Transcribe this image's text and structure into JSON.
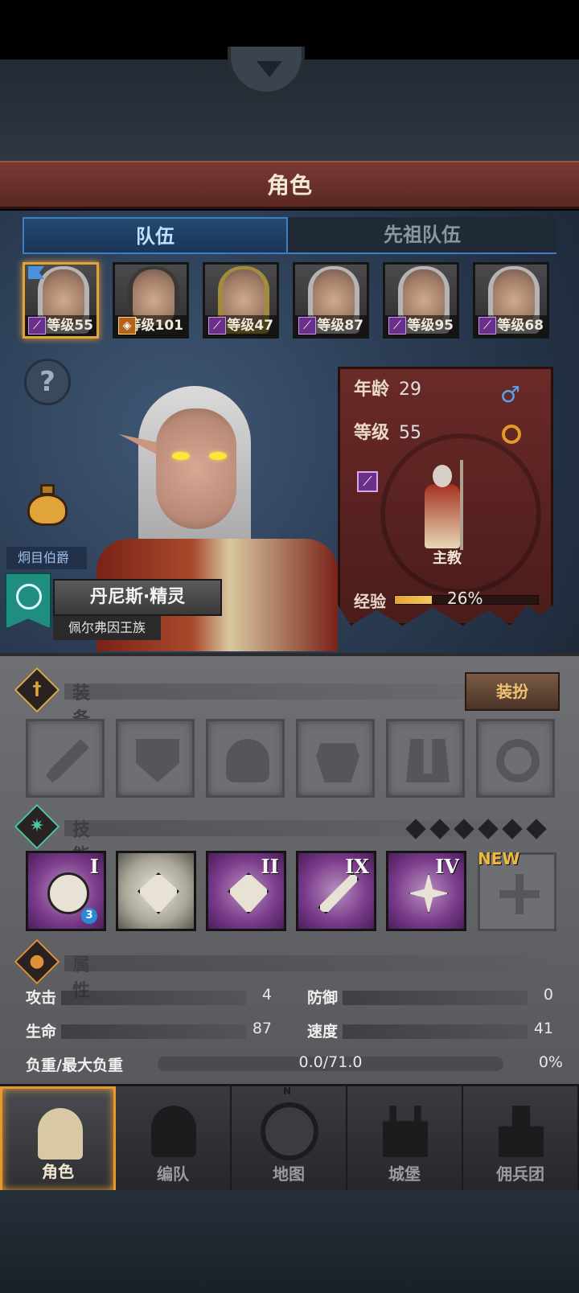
{
  "header": {
    "title": "角色"
  },
  "tabs": [
    {
      "label": "队伍",
      "active": true
    },
    {
      "label": "先祖队伍",
      "active": false
    }
  ],
  "roster": [
    {
      "level": "等级55",
      "class_icon": "staff-icon",
      "hair": "silver",
      "selected": true
    },
    {
      "level": "等级101",
      "class_icon": "shield-icon",
      "hair": "dark",
      "selected": false
    },
    {
      "level": "等级47",
      "class_icon": "staff-icon",
      "hair": "gold",
      "selected": false
    },
    {
      "level": "等级87",
      "class_icon": "staff-icon",
      "hair": "silver",
      "selected": false
    },
    {
      "level": "等级95",
      "class_icon": "staff-icon",
      "hair": "silver",
      "selected": false
    },
    {
      "level": "等级68",
      "class_icon": "staff-icon",
      "hair": "silver",
      "selected": false
    }
  ],
  "character": {
    "noble_title": "炯目伯爵",
    "name": "丹尼斯·精灵",
    "house": "佩尔弗因王族",
    "age_label": "年龄",
    "age": "29",
    "level_label": "等级",
    "level": "55",
    "class_name": "主教",
    "xp_label": "经验",
    "xp_percent": "26%",
    "xp_fraction": 0.26,
    "gender_icon": "male-icon"
  },
  "equipment": {
    "title": "装备",
    "dress_button": "装扮",
    "slots": [
      "weapon",
      "shield",
      "helmet",
      "armor",
      "boots",
      "ring"
    ]
  },
  "skills": {
    "title": "技能",
    "items": [
      {
        "name": "whirlwind",
        "rank": "I",
        "badge": "3",
        "tone": "purple"
      },
      {
        "name": "crystal-blessing",
        "rank": "",
        "badge": "",
        "tone": "light"
      },
      {
        "name": "crystal-hand",
        "rank": "II",
        "badge": "",
        "tone": "purple"
      },
      {
        "name": "staff-strike",
        "rank": "IX",
        "badge": "",
        "tone": "purple"
      },
      {
        "name": "holy-star",
        "rank": "IV",
        "badge": "",
        "tone": "purple"
      }
    ],
    "new_label": "NEW"
  },
  "attributes": {
    "title": "属性",
    "attack_label": "攻击",
    "attack": "4",
    "defense_label": "防御",
    "defense": "0",
    "hp_label": "生命",
    "hp": "87",
    "speed_label": "速度",
    "speed": "41",
    "load_label": "负重/最大负重",
    "load": "0.0/71.0",
    "load_pct": "0%"
  },
  "nav": [
    {
      "label": "角色",
      "active": true
    },
    {
      "label": "编队",
      "active": false
    },
    {
      "label": "地图",
      "active": false
    },
    {
      "label": "城堡",
      "active": false
    },
    {
      "label": "佣兵团",
      "active": false
    }
  ],
  "nav_compass": "N"
}
